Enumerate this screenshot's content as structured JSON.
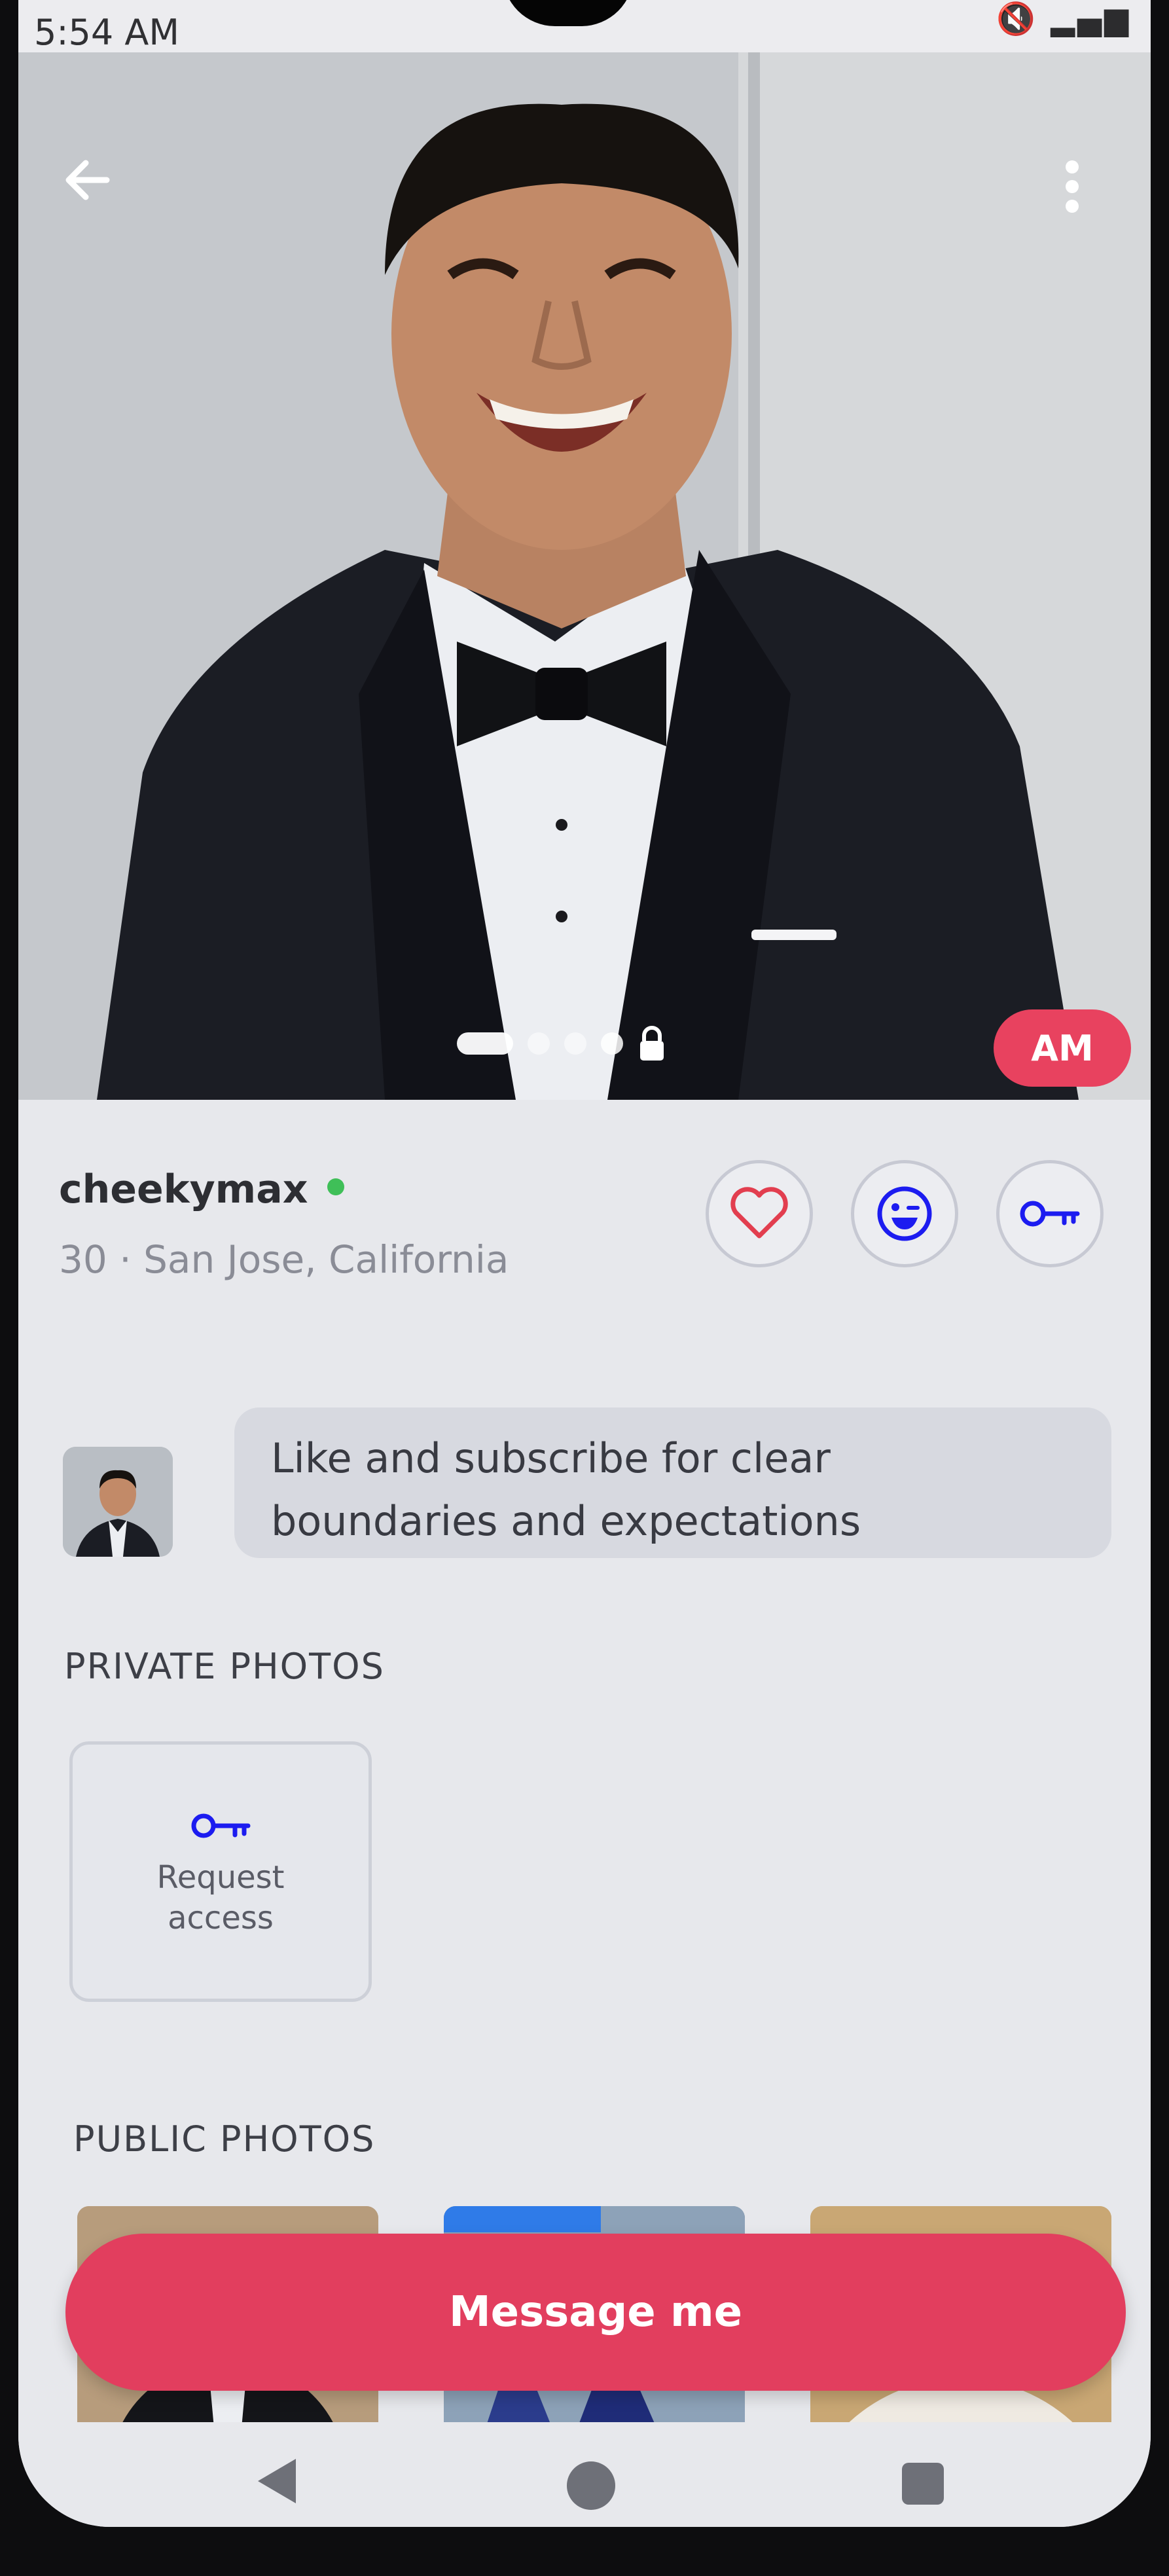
{
  "status_bar": {
    "time": "5:54 AM",
    "icons": [
      "mute-icon",
      "signal-icon",
      "battery-icon"
    ]
  },
  "profile": {
    "initials": "AM",
    "username": "cheekymax",
    "online": true,
    "age_location": "30 · San Jose, California",
    "photo_count": 4,
    "active_photo_index": 0,
    "bio": {
      "line1": "Like and subscribe for clear",
      "line2": "boundaries and expectations"
    }
  },
  "actions": {
    "icons": [
      "heart-icon",
      "wink-icon",
      "key-icon"
    ]
  },
  "private_photos": {
    "label": "PRIVATE PHOTOS",
    "request_line1": "Request",
    "request_line2": "access"
  },
  "public_photos": {
    "label": "PUBLIC PHOTOS"
  },
  "cta": {
    "message_label": "Message me"
  },
  "colors": {
    "accent": "#e23e5e",
    "icon_blue": "#1c1cf0",
    "online": "#3fbf58",
    "background": "#e7e8ec"
  }
}
